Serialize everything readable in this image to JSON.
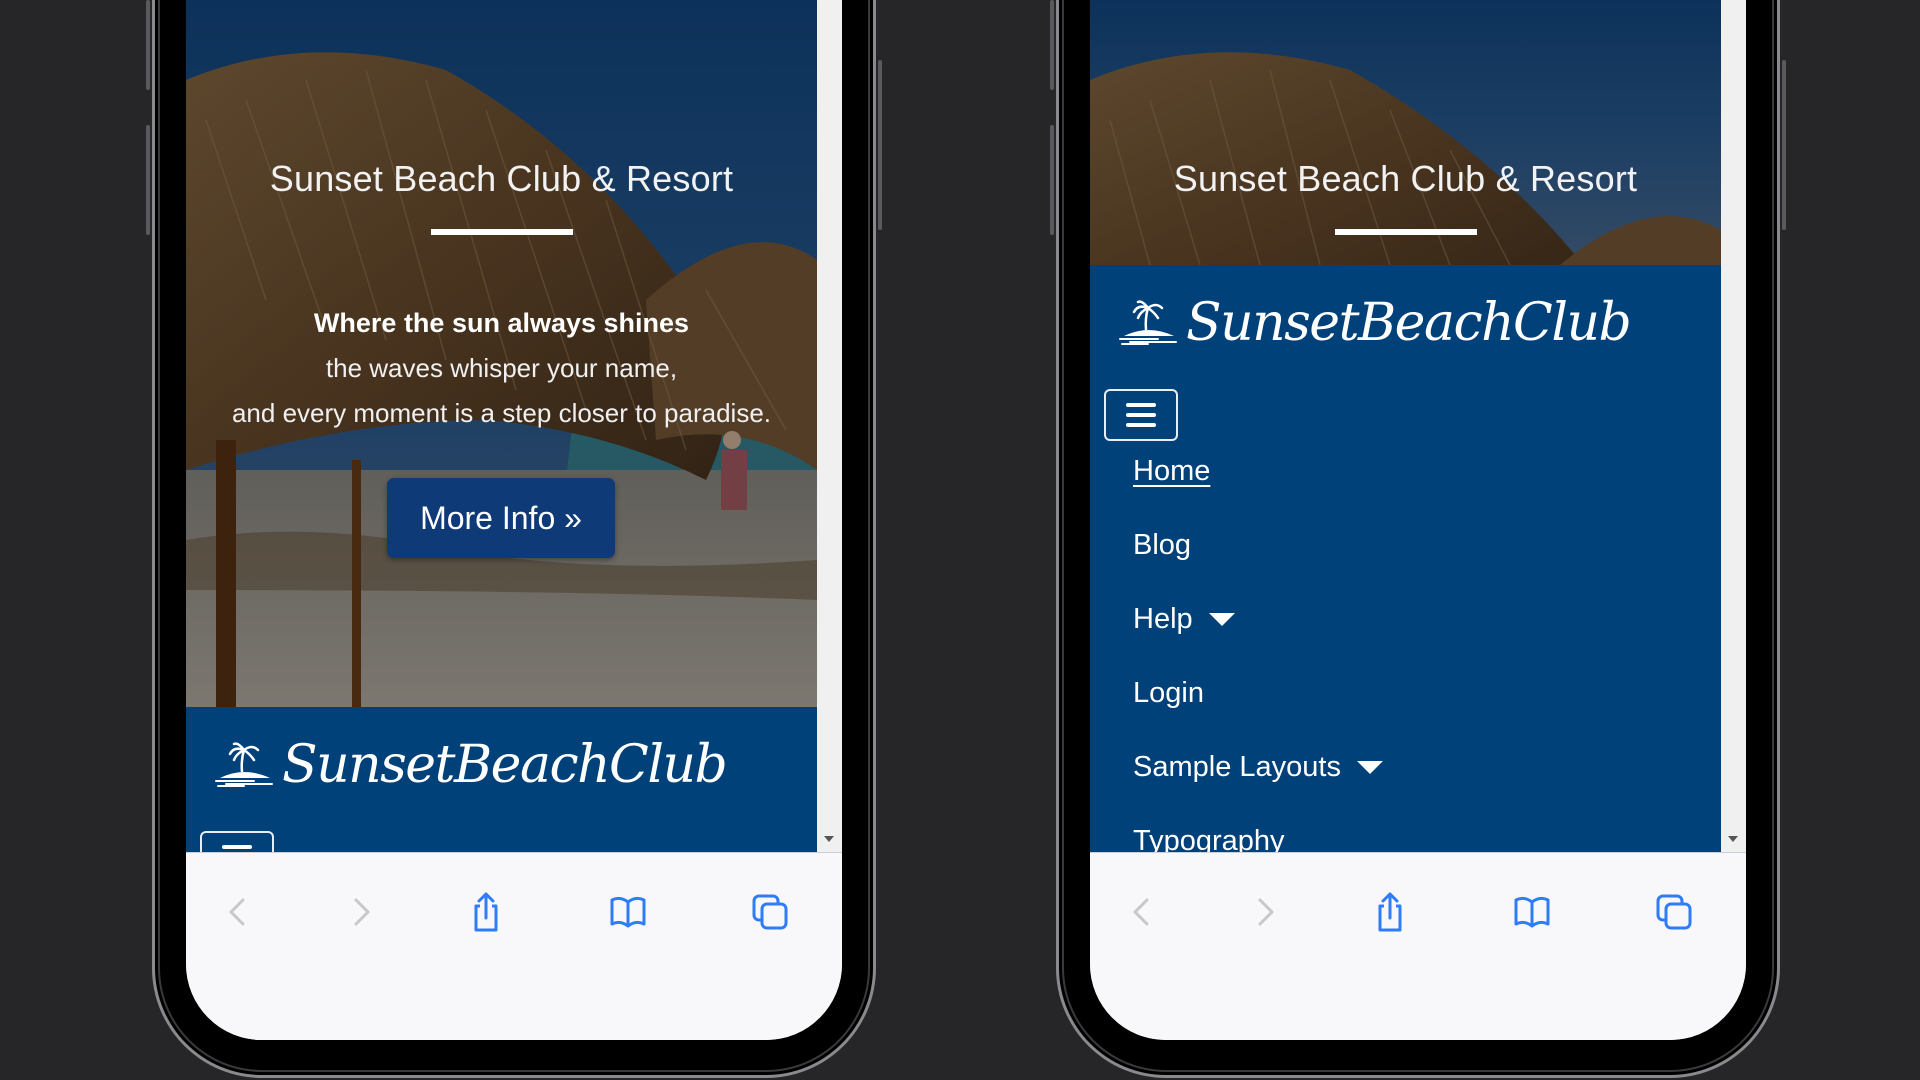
{
  "hero": {
    "title": "Sunset Beach Club & Resort",
    "tagline": [
      "Where the sun always shines",
      "the waves whisper your name,",
      "and every moment is a step closer to paradise."
    ],
    "cta_label": "More Info »"
  },
  "brand": {
    "name": "SunsetBeachClub",
    "icon": "palm-island-icon"
  },
  "nav": {
    "toggle_icon": "hamburger-icon",
    "items": [
      {
        "label": "Home",
        "active": true,
        "dropdown": false
      },
      {
        "label": "Blog",
        "active": false,
        "dropdown": false
      },
      {
        "label": "Help",
        "active": false,
        "dropdown": true
      },
      {
        "label": "Login",
        "active": false,
        "dropdown": false
      },
      {
        "label": "Sample Layouts",
        "active": false,
        "dropdown": true
      },
      {
        "label": "Typography",
        "active": false,
        "dropdown": false
      }
    ]
  },
  "browser_toolbar": {
    "buttons": [
      {
        "name": "back",
        "icon": "chevron-left-icon",
        "enabled": false
      },
      {
        "name": "forward",
        "icon": "chevron-right-icon",
        "enabled": false
      },
      {
        "name": "share",
        "icon": "share-icon",
        "enabled": true
      },
      {
        "name": "bookmarks",
        "icon": "book-icon",
        "enabled": true
      },
      {
        "name": "tabs",
        "icon": "tabs-icon",
        "enabled": true
      }
    ]
  },
  "colors": {
    "navbar": "#00417a",
    "cta_button": "#0e3a78",
    "toolbar_icon_active": "#2f7cf6",
    "toolbar_icon_disabled": "#c8c8cc",
    "background": "#262628"
  }
}
